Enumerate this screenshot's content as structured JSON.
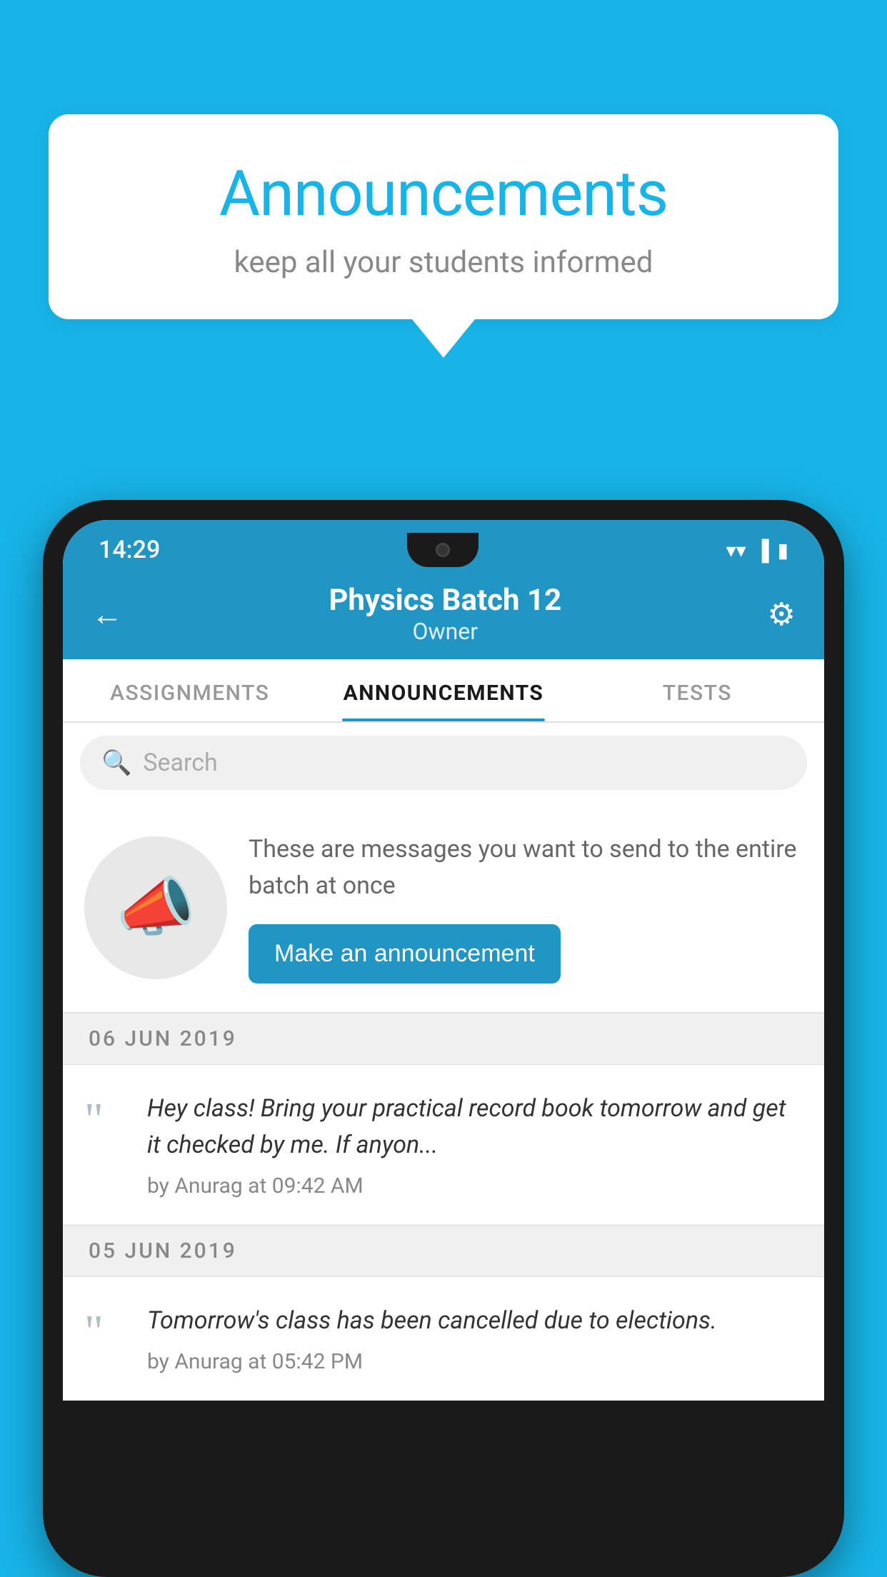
{
  "background": {
    "color": "#18b4e8"
  },
  "speech_bubble": {
    "title": "Announcements",
    "subtitle": "keep all your students informed"
  },
  "phone": {
    "status_bar": {
      "time": "14:29",
      "icons": [
        "wifi",
        "signal",
        "battery"
      ]
    },
    "header": {
      "title": "Physics Batch 12",
      "subtitle": "Owner",
      "back_label": "←",
      "gear_label": "⚙"
    },
    "tabs": [
      {
        "label": "ASSIGNMENTS",
        "active": false
      },
      {
        "label": "ANNOUNCEMENTS",
        "active": true
      },
      {
        "label": "TESTS",
        "active": false
      }
    ],
    "search": {
      "placeholder": "Search"
    },
    "announcement_prompt": {
      "description": "These are messages you want to send to the entire batch at once",
      "button_label": "Make an announcement"
    },
    "messages": [
      {
        "date": "06  JUN  2019",
        "text": "Hey class! Bring your practical record book tomorrow and get it checked by me. If anyon...",
        "author": "by Anurag at 09:42 AM"
      },
      {
        "date": "05  JUN  2019",
        "text": "Tomorrow's class has been cancelled due to elections.",
        "author": "by Anurag at 05:42 PM"
      }
    ]
  }
}
